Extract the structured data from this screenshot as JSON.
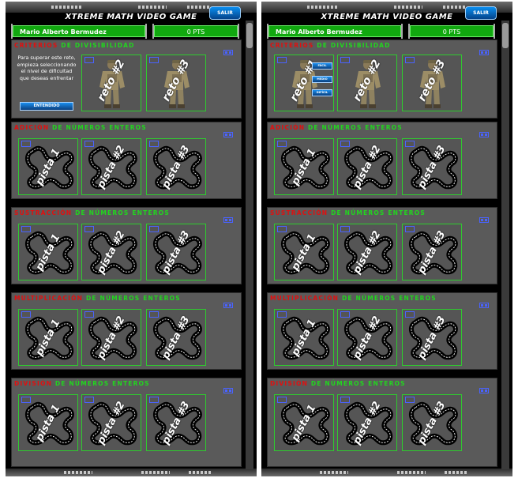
{
  "screens": [
    {
      "title": "XTREME MATH VIDEO GAME",
      "salir": "SALIR",
      "player_name": "Mario Alberto Bermudez",
      "points": "0 PTS",
      "criteria": {
        "title_red": "CRITERIOS",
        "title_green": "DE DIVISIBILIDAD",
        "instructions": "Para superar este reto, empieza seleccionando el nivel de dificultad que deseas enfrentar",
        "button": "ENTENDIDO",
        "cards": [
          "reto #2",
          "reto #3"
        ]
      },
      "sections": [
        {
          "title_red": "ADICIÓN",
          "title_green": "DE NÚMEROS ENTEROS",
          "cards": [
            "pista 1",
            "pista #2",
            "pista #3"
          ]
        },
        {
          "title_red": "SUSTRACCIÓN",
          "title_green": "DE NÚMEROS ENTEROS",
          "cards": [
            "pista 1",
            "pista #2",
            "pista #3"
          ]
        },
        {
          "title_red": "MULTIPLICACIÓN",
          "title_green": "DE NÚMEROS ENTEROS",
          "cards": [
            "pista 1",
            "pista #2",
            "pista #3"
          ]
        },
        {
          "title_red": "DIVISIÓN",
          "title_green": "DE NÚMEROS ENTEROS",
          "cards": [
            "pista 1",
            "pista #2",
            "pista #3"
          ]
        }
      ]
    },
    {
      "title": "XTREME MATH VIDEO GAME",
      "salir": "SALIR",
      "player_name": "Mario Alberto Bermudez",
      "points": "0 PTS",
      "criteria": {
        "title_red": "CRITERIOS",
        "title_green": "DE DIVISIBILIDAD",
        "cards": [
          "reto #1",
          "reto #2",
          "reto #3"
        ],
        "levels": [
          "FÁCIL",
          "MEDIO",
          "DIFÍCIL"
        ]
      },
      "sections": [
        {
          "title_red": "ADICIÓN",
          "title_green": "DE NÚMEROS ENTEROS",
          "cards": [
            "pista 1",
            "pista #2",
            "pista #3"
          ]
        },
        {
          "title_red": "SUSTRACCIÓN",
          "title_green": "DE NÚMEROS ENTEROS",
          "cards": [
            "pista 1",
            "pista #2",
            "pista #3"
          ]
        },
        {
          "title_red": "MULTIPLICACIÓN",
          "title_green": "DE NÚMEROS ENTEROS",
          "cards": [
            "pista 1",
            "pista #2",
            "pista #3"
          ]
        },
        {
          "title_red": "DIVISIÓN",
          "title_green": "DE NÚMEROS ENTEROS",
          "cards": [
            "pista 1",
            "pista #2",
            "pista #3"
          ]
        }
      ]
    }
  ]
}
